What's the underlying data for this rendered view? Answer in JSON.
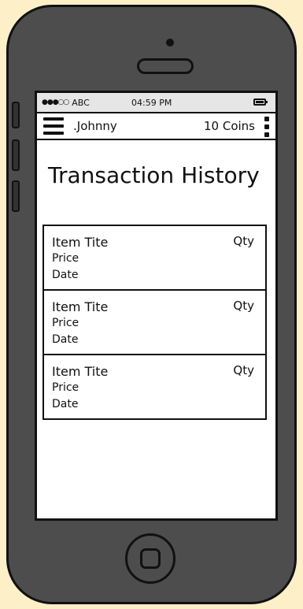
{
  "status_bar": {
    "signal": "●●●○○",
    "carrier": "ABC",
    "time": "04:59 PM"
  },
  "nav_bar": {
    "username": ".Johnny",
    "coins": "10 Coins"
  },
  "page": {
    "title": "Transaction History"
  },
  "transactions": [
    {
      "title": "Item Tite",
      "qty": "Qty",
      "price": "Price",
      "date": "Date"
    },
    {
      "title": "Item Tite",
      "qty": "Qty",
      "price": "Price",
      "date": "Date"
    },
    {
      "title": "Item Tite",
      "qty": "Qty",
      "price": "Price",
      "date": "Date"
    }
  ],
  "icons": {
    "menu": "hamburger-menu-icon",
    "more": "vertical-more-icon",
    "battery": "battery-icon",
    "home": "home-button-icon"
  }
}
